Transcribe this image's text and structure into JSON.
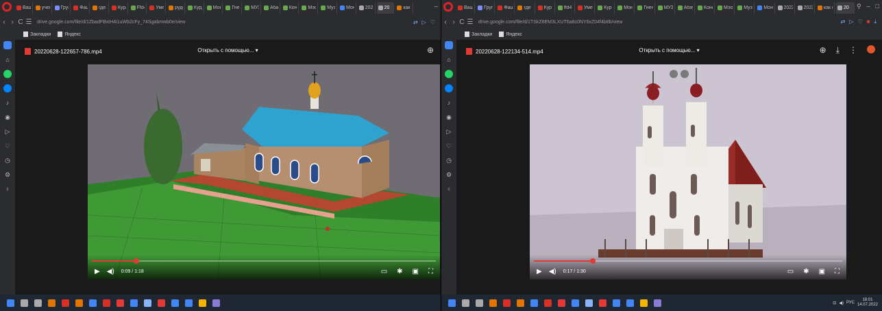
{
  "left": {
    "window": {
      "tabs": [
        {
          "label": "Ваш",
          "color": "#d93025"
        },
        {
          "label": "учен",
          "color": "#e37400"
        },
        {
          "label": "Груп",
          "color": "#7c8cff"
        },
        {
          "label": "Фашу",
          "color": "#d93025"
        },
        {
          "label": "где и",
          "color": "#e37400"
        },
        {
          "label": "Кура",
          "color": "#d93025"
        },
        {
          "label": "Ffd4",
          "color": "#6aa84f"
        },
        {
          "label": "Умен",
          "color": "#d93025"
        },
        {
          "label": "рудо",
          "color": "#e37400"
        },
        {
          "label": "Курд",
          "color": "#6aa84f"
        },
        {
          "label": "Мон",
          "color": "#6aa84f"
        },
        {
          "label": "Гнен",
          "color": "#6aa84f"
        },
        {
          "label": "МУЗ",
          "color": "#6aa84f"
        },
        {
          "label": "Абау",
          "color": "#6aa84f"
        },
        {
          "label": "Коно",
          "color": "#6aa84f"
        },
        {
          "label": "Мэо",
          "color": "#6aa84f"
        },
        {
          "label": "Музы",
          "color": "#6aa84f"
        },
        {
          "label": "Мон",
          "color": "#4285f4"
        },
        {
          "label": "2022",
          "color": "#aaa"
        },
        {
          "label": "20",
          "color": "#aaa",
          "active": true
        },
        {
          "label": "как с",
          "color": "#e37400"
        }
      ],
      "url": "drive.google.com/file/d/1ZbadFBxtH4i1uWb2cFy_74Sgabmwb0e/view",
      "bookmarks": [
        "Закладки",
        "Яндекс"
      ]
    },
    "viewer": {
      "file_name": "20220628-122657-786.mp4",
      "open_with": "Открыть с помощью... ▾",
      "time": "0:09 / 1:18",
      "progress": 0.13
    }
  },
  "right": {
    "window": {
      "tabs": [
        {
          "label": "Ваш",
          "color": "#d93025"
        },
        {
          "label": "Груп",
          "color": "#7c8cff"
        },
        {
          "label": "Фаш",
          "color": "#d93025"
        },
        {
          "label": "где",
          "color": "#e37400"
        },
        {
          "label": "Кур",
          "color": "#d93025"
        },
        {
          "label": "ffd4",
          "color": "#6aa84f"
        },
        {
          "label": "Умен",
          "color": "#d93025"
        },
        {
          "label": "Кур",
          "color": "#6aa84f"
        },
        {
          "label": "Мон",
          "color": "#6aa84f"
        },
        {
          "label": "Гнен",
          "color": "#6aa84f"
        },
        {
          "label": "МУЗ",
          "color": "#6aa84f"
        },
        {
          "label": "Абау",
          "color": "#6aa84f"
        },
        {
          "label": "Коно",
          "color": "#6aa84f"
        },
        {
          "label": "Мэо",
          "color": "#6aa84f"
        },
        {
          "label": "Музы",
          "color": "#6aa84f"
        },
        {
          "label": "Мон",
          "color": "#4285f4"
        },
        {
          "label": "2022",
          "color": "#aaa"
        },
        {
          "label": "2022",
          "color": "#aaa"
        },
        {
          "label": "как с",
          "color": "#e37400"
        },
        {
          "label": "20",
          "color": "#aaa",
          "active": true
        }
      ],
      "url": "drive.google.com/file/d/1TSkZ6EM3LXUT6a8c0NY6xZ04f4b8b/view",
      "bookmarks": [
        "Закладки",
        "Яндекс"
      ]
    },
    "viewer": {
      "file_name": "20220628-122134-514.mp4",
      "open_with": "Открыть с помощью... ▾",
      "time": "0:17 / 1:30",
      "progress": 0.19
    },
    "tray": {
      "lang": "РУС",
      "time": "18:01",
      "date": "14.07.2022"
    }
  },
  "icons": {
    "back": "‹",
    "forward": "›",
    "reload": "C",
    "menu": "☰",
    "play": "▶",
    "volume": "◀)",
    "subs": "▭",
    "settings": "✱",
    "miniplayer": "▣",
    "fullscreen": "⛶",
    "add": "⊕",
    "download": "⤓",
    "more": "⋮"
  }
}
